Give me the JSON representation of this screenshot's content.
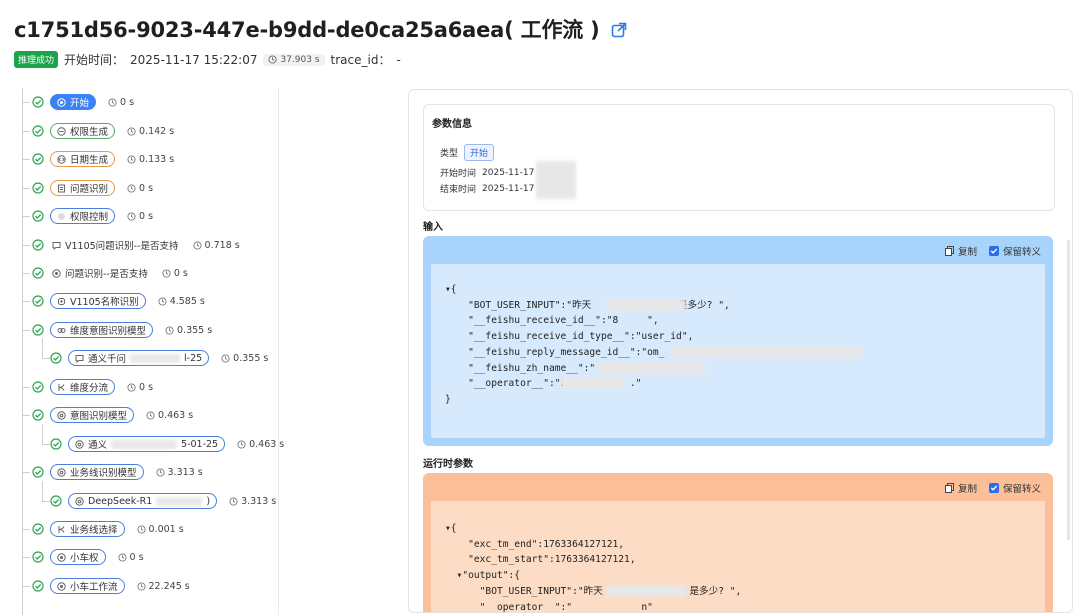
{
  "header": {
    "title": "c1751d56-9023-447e-b9dd-de0ca25a6aea( 工作流 )",
    "status_badge": "推理成功",
    "start_label": "开始时间：",
    "start_time": "2025-11-17 15:22:07",
    "duration": "37.903 s",
    "trace_label": "trace_id：",
    "trace_value": "-"
  },
  "tree": [
    {
      "label": "开始",
      "time": "0 s",
      "style": "start",
      "icon": "circle-dot-icon"
    },
    {
      "label": "权限生成",
      "time": "0.142 s",
      "style": "green",
      "icon": "minus-circle-icon"
    },
    {
      "label": "日期生成",
      "time": "0.133 s",
      "style": "orange",
      "icon": "code-icon"
    },
    {
      "label": "问题识别",
      "time": "0 s",
      "style": "orange",
      "icon": "doc-icon"
    },
    {
      "label": "权限控制",
      "time": "0 s",
      "style": "blue",
      "icon": "blurred-icon"
    },
    {
      "label": "V1105问题识别--是否支持",
      "time": "0.718 s",
      "style": "plain",
      "icon": "chat-icon"
    },
    {
      "label": "问题识别--是否支持",
      "time": "0 s",
      "style": "plain",
      "icon": "circle-dot-icon"
    },
    {
      "label": "V1105名称识别",
      "time": "4.585 s",
      "style": "blue",
      "icon": "model-icon"
    },
    {
      "label": "维度意图识别模型",
      "time": "0.355 s",
      "style": "blue",
      "icon": "link-icon"
    },
    {
      "label": "通义千问",
      "label_tail": "l-25",
      "time": "0.355 s",
      "style": "blue",
      "icon": "chat-icon"
    },
    {
      "label": "维度分流",
      "time": "0 s",
      "style": "blue",
      "icon": "branch-icon"
    },
    {
      "label": "意图识别模型",
      "time": "0.463 s",
      "style": "blue",
      "icon": "gear-icon"
    },
    {
      "label": "通义",
      "label_tail": "5-01-25",
      "time": "0.463 s",
      "style": "blue",
      "icon": "gear-icon"
    },
    {
      "label": "业务线识别模型",
      "time": "3.313 s",
      "style": "blue",
      "icon": "gear-icon"
    },
    {
      "label": "DeepSeek-R1",
      "label_tail": ")",
      "time": "3.313 s",
      "style": "blue",
      "icon": "gear-icon"
    },
    {
      "label": "业务线选择",
      "time": "0.001 s",
      "style": "blue",
      "icon": "branch-icon"
    },
    {
      "label": "小车权",
      "time": "0 s",
      "style": "blue",
      "icon": "circle-dot-icon"
    },
    {
      "label": "小车工作流",
      "time": "22.245 s",
      "style": "blue",
      "icon": "circle-dot-icon"
    }
  ],
  "params": {
    "title": "参数信息",
    "type_label": "类型",
    "type_value": "开始",
    "start_label": "开始时间",
    "start_value": "2025-11-17",
    "end_label": "结束时间",
    "end_value": "2025-11-17"
  },
  "input": {
    "title": "输入",
    "copy": "复制",
    "keep_escape": "保留转义",
    "json": "▾{\n    \"BOT_USER_INPUT\":\"昨天               是多少? \",\n    \"__feishu_receive_id__\":\"8     \",\n    \"__feishu_receive_id_type__\":\"user_id\",\n    \"__feishu_reply_message_id__\":\"om_                                ,\n    \"__feishu_zh_name__\":\"               \",\n    \"__operator__\":\"z           .\"\n}"
  },
  "runtime": {
    "title": "运行时参数",
    "copy": "复制",
    "keep_escape": "保留转义",
    "json": "▾{\n    \"exc_tm_end\":1763364127121,\n    \"exc_tm_start\":1763364127121,\n  ▾\"output\":{\n      \"BOT_USER_INPUT\":\"昨天               是多少? \",\n      \"__operator__\":\"            n\""
  },
  "colors": {
    "accent": "#3b82f6",
    "success": "#1aa34a",
    "input_bg": "#a8d4fb",
    "runtime_bg": "#fbbf9a"
  }
}
